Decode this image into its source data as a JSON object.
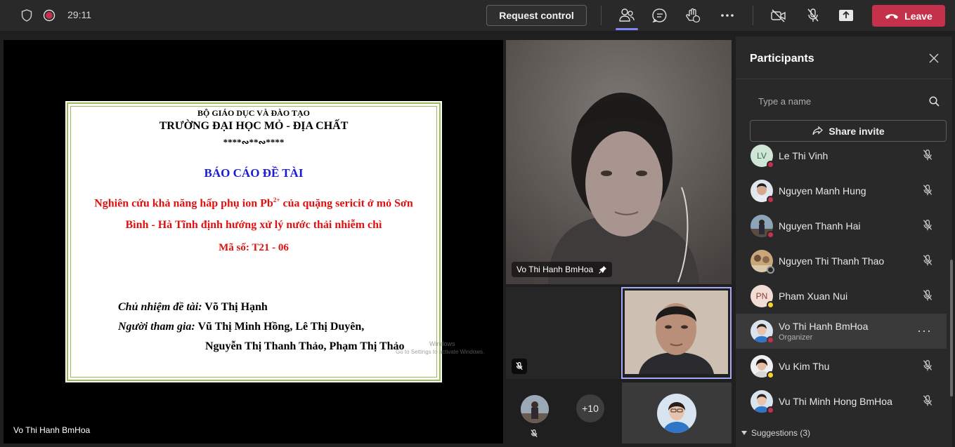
{
  "topbar": {
    "timer": "29:11",
    "request_control_label": "Request control",
    "leave_label": "Leave",
    "icons": [
      "shield-icon",
      "recording-icon",
      "people-icon",
      "chat-icon",
      "raise-hand-icon",
      "more-icon",
      "camera-off-icon",
      "mic-off-icon",
      "share-tray-icon",
      "phone-icon"
    ],
    "colors": {
      "leave": "#c4314b",
      "accent": "#7f85f5",
      "recording": "#c4314b"
    }
  },
  "stage": {
    "presenter_name": "Vo Thi Hanh BmHoa",
    "slide": {
      "line1": "BỘ GIÁO DỤC VÀ ĐÀO TẠO",
      "line2": "TRƯỜNG  ĐẠI HỌC MỎ - ĐỊA CHẤT",
      "ornament": "****∾**∾****",
      "report_title": "BÁO CÁO ĐỀ TÀI",
      "topic_line1_before": "Nghiên cứu khả năng hấp phụ ion Pb",
      "topic_sup": "2+",
      "topic_line1_after": " của quặng sericit ở mỏ Sơn",
      "topic_line2": "Bình - Hà Tĩnh định hướng xử lý nước thải nhiễm chì",
      "code": "Mã số: T21 - 06",
      "lead_label": "Chủ nhiệm đề tài:",
      "lead_value": " Võ Thị Hạnh",
      "members_label": "Người tham gia:",
      "members_value1": " Vũ Thị Minh Hồng, Lê Thị Duyên,",
      "members_value2": "Nguyễn Thị Thanh Thảo, Phạm Thị Thảo",
      "watermark1": "Windows",
      "watermark2": "Go to Settings to activate Windows."
    },
    "colors": {
      "slide_title": "#1a1ad6",
      "slide_topic": "#e01010",
      "slide_border": "#9bbb59"
    }
  },
  "videos": {
    "main_tile_name": "Vo Thi Hanh BmHoa",
    "overflow_count": "+10"
  },
  "panel": {
    "title": "Participants",
    "search_placeholder": "Type a name",
    "share_invite_label": "Share invite",
    "participants": [
      {
        "name": "Le Thi Vinh",
        "initials": "LV",
        "role": "",
        "status": "busy"
      },
      {
        "name": "Nguyen Manh Hung",
        "initials": "",
        "role": "",
        "status": "busy"
      },
      {
        "name": "Nguyen Thanh Hai",
        "initials": "",
        "role": "",
        "status": "busy"
      },
      {
        "name": "Nguyen Thi Thanh Thao",
        "initials": "",
        "role": "",
        "status": "offline"
      },
      {
        "name": "Pham Xuan Nui",
        "initials": "PN",
        "role": "",
        "status": "away"
      },
      {
        "name": "Vo Thi Hanh BmHoa",
        "initials": "",
        "role": "Organizer",
        "status": "busy"
      },
      {
        "name": "Vu Kim Thu",
        "initials": "",
        "role": "",
        "status": "away"
      },
      {
        "name": "Vu Thi Minh Hong BmHoa",
        "initials": "",
        "role": "",
        "status": "busy"
      }
    ],
    "suggestions_label": "Suggestions (3)"
  }
}
